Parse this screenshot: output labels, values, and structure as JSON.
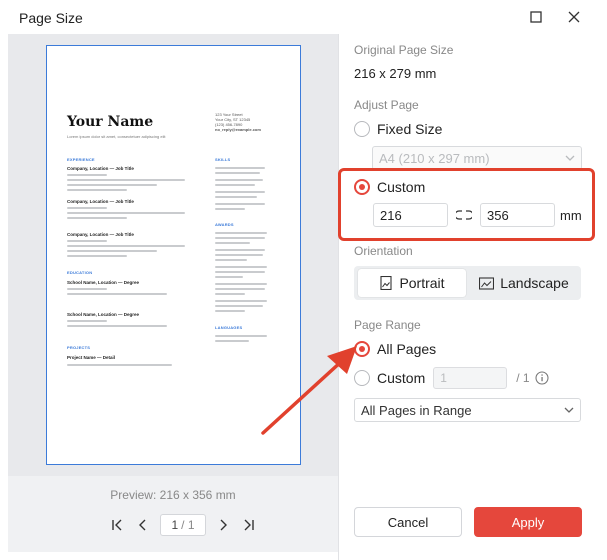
{
  "window": {
    "title": "Page Size",
    "icons": {
      "maximize": "maximize-icon",
      "close": "close-icon"
    }
  },
  "preview": {
    "label": "Preview:  216 x 356 mm",
    "page_current": "1",
    "page_total": "/ 1",
    "document": {
      "name": "Your Name",
      "tagline": "Lorem ipsum dolor sit amet, consectetuer adipiscing elit",
      "contact": [
        "123 Your Street",
        "Your City, ST 12345",
        "(123) 456-7890",
        "no_reply@example.com"
      ],
      "experience_heading": "EXPERIENCE",
      "experience": [
        {
          "title": "Company, Location — Job Title",
          "dates": "MONTH 20XX - PRESENT"
        },
        {
          "title": "Company, Location — Job Title",
          "dates": "MONTH 20XX - MONTH 20XX"
        },
        {
          "title": "Company, Location — Job Title",
          "dates": "MONTH 20XX - MONTH 20XX"
        }
      ],
      "education_heading": "EDUCATION",
      "education": [
        {
          "title": "School Name, Location — Degree",
          "dates": "MONTH 20XX - MONTH 20XX"
        },
        {
          "title": "School Name, Location — Degree",
          "dates": "MONTH 20XX - MONTH 20XX"
        }
      ],
      "projects_heading": "PROJECTS",
      "project": "Project Name — Detail",
      "skills_heading": "SKILLS",
      "awards_heading": "AWARDS",
      "languages_heading": "LANGUAGES"
    }
  },
  "settings": {
    "original_label": "Original Page Size",
    "original_value": "216 x 279 mm",
    "adjust_label": "Adjust Page",
    "fixed_size_label": "Fixed Size",
    "fixed_size_select": "A4 (210 x 297 mm)",
    "custom_label": "Custom",
    "width_value": "216",
    "height_value": "356",
    "unit": "mm",
    "orientation_label": "Orientation",
    "portrait_label": "Portrait",
    "landscape_label": "Landscape",
    "page_range_label": "Page Range",
    "all_pages_label": "All Pages",
    "custom_range_label": "Custom",
    "custom_range_value": "1",
    "custom_range_total": "/ 1",
    "range_select": "All Pages in Range"
  },
  "buttons": {
    "cancel": "Cancel",
    "apply": "Apply"
  },
  "colors": {
    "accent": "#e5473c",
    "highlight": "#e1412d",
    "page_border": "#3c7bd9"
  }
}
